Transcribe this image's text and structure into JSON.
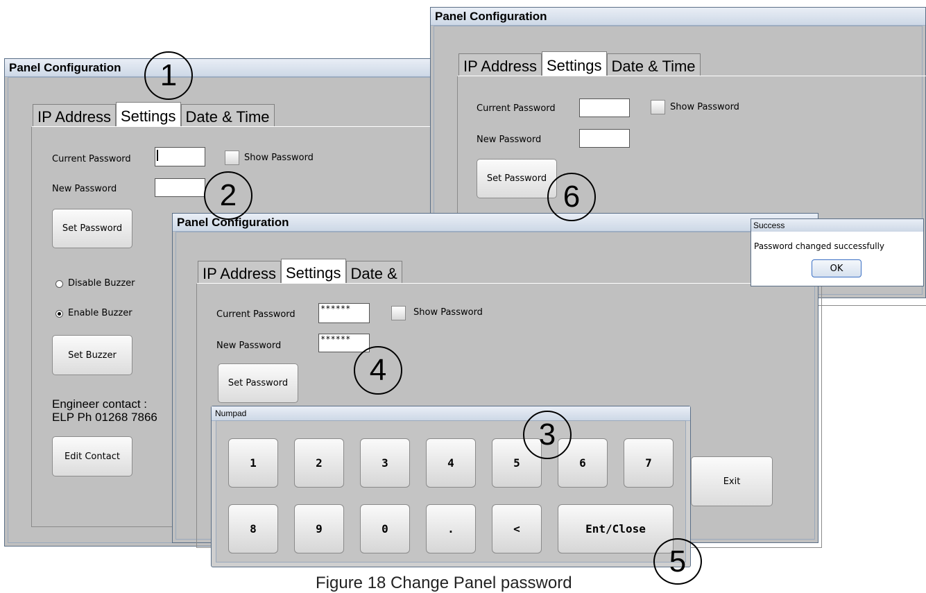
{
  "windowTitle": "Panel Configuration",
  "tabs": [
    "IP Address",
    "Settings",
    "Date & Time"
  ],
  "tabsClipped": [
    "IP Address",
    "Settings",
    "Date &"
  ],
  "labels": {
    "currentPassword": "Current Password",
    "newPassword": "New Password",
    "showPassword": "Show Password",
    "disableBuzzer": "Disable Buzzer",
    "enableBuzzer": "Enable Buzzer"
  },
  "buttons": {
    "setPassword": "Set Password",
    "setBuzzer": "Set Buzzer",
    "editContact": "Edit Contact",
    "exit": "Exit",
    "ok": "OK"
  },
  "engineer": {
    "line1": "Engineer contact :",
    "line2": "ELP Ph 01268 7866"
  },
  "masked": {
    "current": "******",
    "new": "******"
  },
  "numpad": {
    "title": "Numpad",
    "row1": [
      "1",
      "2",
      "3",
      "4",
      "5",
      "6",
      "7"
    ],
    "row2": [
      "8",
      "9",
      "0",
      ".",
      "<",
      "Ent/Close"
    ]
  },
  "success": {
    "title": "Success",
    "message": "Password changed successfully"
  },
  "callouts": [
    "1",
    "2",
    "3",
    "4",
    "5",
    "6"
  ],
  "caption": "Figure 18 Change Panel password",
  "radios": {
    "window1": {
      "disable": false,
      "enable": true
    },
    "window3": {
      "disable": true,
      "enable": false
    }
  }
}
